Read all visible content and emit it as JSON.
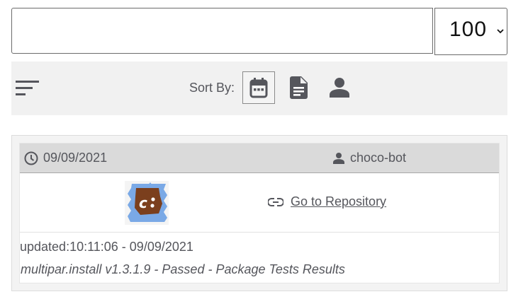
{
  "search": {
    "value": "",
    "placeholder": ""
  },
  "page_size": {
    "selected": "100"
  },
  "sort": {
    "label": "Sort By:",
    "options": [
      {
        "name": "date",
        "icon": "calendar-icon",
        "active": true
      },
      {
        "name": "package",
        "icon": "document-icon",
        "active": false
      },
      {
        "name": "author",
        "icon": "user-icon",
        "active": false
      }
    ]
  },
  "results": [
    {
      "date": "09/09/2021",
      "author": "choco-bot",
      "link_label": "Go to Repository",
      "updated": "updated:10:11:06 - 09/09/2021",
      "status": "multipar.install v1.3.1.9 - Passed - Package Tests Results"
    }
  ],
  "colors": {
    "icon": "#55565c",
    "header": "#dadada",
    "bar": "#f1f1f1",
    "logo_bg": "#7aa9e6",
    "logo_choc": "#7b3f1d"
  }
}
